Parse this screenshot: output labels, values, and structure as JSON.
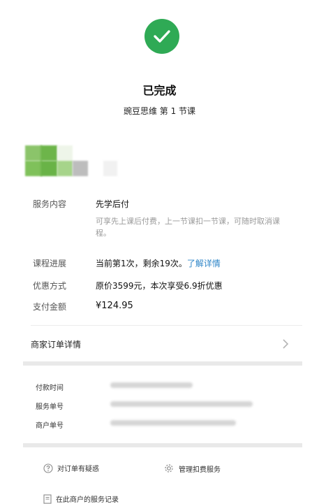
{
  "status": {
    "title": "已完成",
    "subtitle": "豌豆思维 第 1 节课",
    "icon": "check-circle-icon",
    "accent": "#2faa55"
  },
  "details": {
    "service_label": "服务内容",
    "service_value": "先学后付",
    "service_note": "可享先上课后付费，上一节课扣一节课，可随时取消课程。",
    "progress_label": "课程进展",
    "progress_value": "当前第1次，剩余19次。",
    "progress_link": "了解详情",
    "discount_label": "优惠方式",
    "discount_value": "原价3599元，本次享受6.9折优惠",
    "amount_label": "支付金额",
    "amount_value": "¥124.95"
  },
  "merchant": {
    "title": "商家订单详情",
    "pay_time_label": "付款时间",
    "service_no_label": "服务单号",
    "merchant_no_label": "商户单号"
  },
  "actions": {
    "question": "对订单有疑惑",
    "manage": "管理扣费服务",
    "records": "在此商户的服务记录"
  },
  "colors": {
    "link": "#2f86c8",
    "muted": "#9a9a9a"
  }
}
